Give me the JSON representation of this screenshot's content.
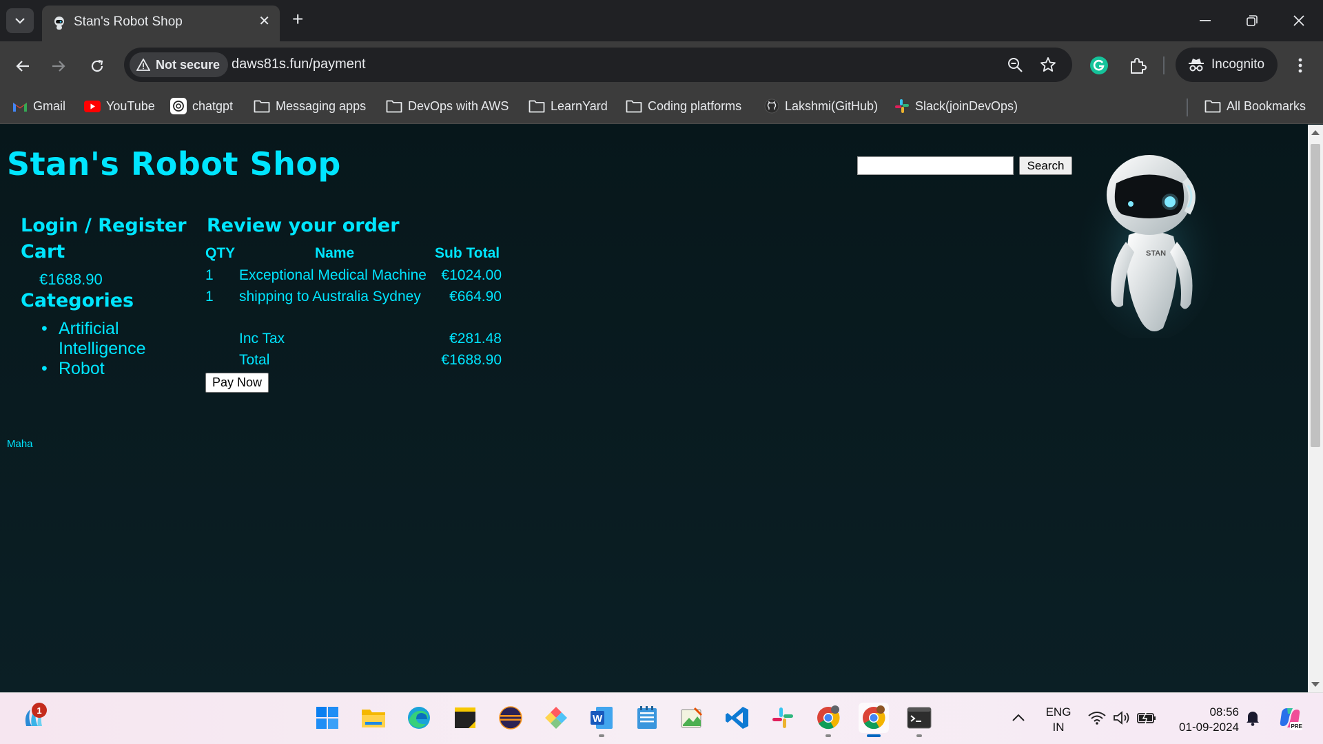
{
  "browser": {
    "tab_title": "Stan's Robot Shop",
    "tab_close": "✕",
    "new_tab": "+",
    "security_label": "Not secure",
    "url": "daws81s.fun/payment",
    "incognito_label": "Incognito"
  },
  "bookmarks": [
    {
      "label": "Gmail",
      "icon": "gmail-icon"
    },
    {
      "label": "YouTube",
      "icon": "youtube-icon"
    },
    {
      "label": "chatgpt",
      "icon": "chatgpt-icon"
    },
    {
      "label": "Messaging apps",
      "icon": "folder-icon"
    },
    {
      "label": "DevOps with AWS",
      "icon": "folder-icon"
    },
    {
      "label": "LearnYard",
      "icon": "folder-icon"
    },
    {
      "label": "Coding platforms",
      "icon": "folder-icon"
    },
    {
      "label": "Lakshmi(GitHub)",
      "icon": "github-icon"
    },
    {
      "label": "Slack(joinDevOps)",
      "icon": "slack-icon"
    }
  ],
  "all_bookmarks": "All Bookmarks",
  "site": {
    "title": "Stan's Robot Shop",
    "search_button": "Search",
    "search_value": "",
    "robot_label": "STAN"
  },
  "sidebar": {
    "login": "Login / Register",
    "cart": "Cart",
    "cart_total": "€1688.90",
    "categories": "Categories",
    "category_items": [
      {
        "line1": "Artificial",
        "line2": "Intelligence"
      },
      {
        "line1": "Robot",
        "line2": ""
      }
    ]
  },
  "order": {
    "heading": "Review your order",
    "columns": {
      "qty": "QTY",
      "name": "Name",
      "subtotal": "Sub Total"
    },
    "rows": [
      {
        "qty": "1",
        "name": "Exceptional Medical Machine",
        "subtotal": "€1024.00"
      },
      {
        "qty": "1",
        "name": "shipping to Australia Sydney",
        "subtotal": "€664.90"
      }
    ],
    "tax_label": "Inc Tax",
    "tax_value": "€281.48",
    "total_label": "Total",
    "total_value": "€1688.90",
    "pay_button": "Pay Now"
  },
  "footer": {
    "name": "Maha"
  },
  "taskbar": {
    "notification_count": "1",
    "lang_line1": "ENG",
    "lang_line2": "IN",
    "time": "08:56",
    "date": "01-09-2024",
    "copilot_badge": "PRE"
  },
  "colors": {
    "accent": "#00e5ff",
    "page_bg": "#0a1a1f",
    "chrome_bg": "#3c3c3c"
  }
}
